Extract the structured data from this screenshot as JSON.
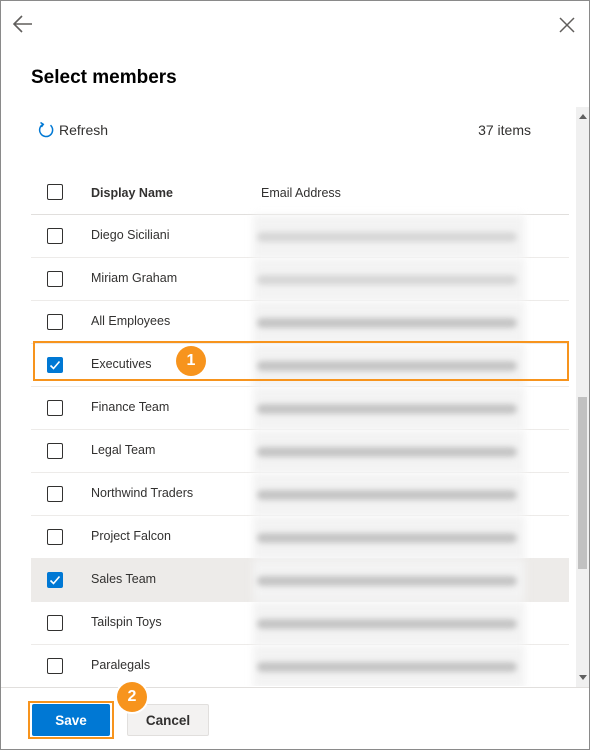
{
  "header": {
    "title": "Select members"
  },
  "toolbar": {
    "refresh_label": "Refresh",
    "item_count": "37 items"
  },
  "table": {
    "columns": [
      "Display Name",
      "Email Address"
    ],
    "rows": [
      {
        "name": "Diego Siciliani",
        "checked": false
      },
      {
        "name": "Miriam Graham",
        "checked": false
      },
      {
        "name": "All Employees",
        "checked": false
      },
      {
        "name": "Executives",
        "checked": true
      },
      {
        "name": "Finance Team",
        "checked": false
      },
      {
        "name": "Legal Team",
        "checked": false
      },
      {
        "name": "Northwind Traders",
        "checked": false
      },
      {
        "name": "Project Falcon",
        "checked": false
      },
      {
        "name": "Sales Team",
        "checked": true
      },
      {
        "name": "Tailspin Toys",
        "checked": false
      },
      {
        "name": "Paralegals",
        "checked": false
      }
    ]
  },
  "callouts": {
    "step1": "1",
    "step2": "2"
  },
  "footer": {
    "save_label": "Save",
    "cancel_label": "Cancel"
  },
  "colors": {
    "accent": "#0078d4",
    "callout": "#f7941d",
    "selected_row": "#edebe9"
  },
  "icons": {
    "back": "arrow-left-icon",
    "close": "close-icon",
    "refresh": "refresh-icon"
  }
}
